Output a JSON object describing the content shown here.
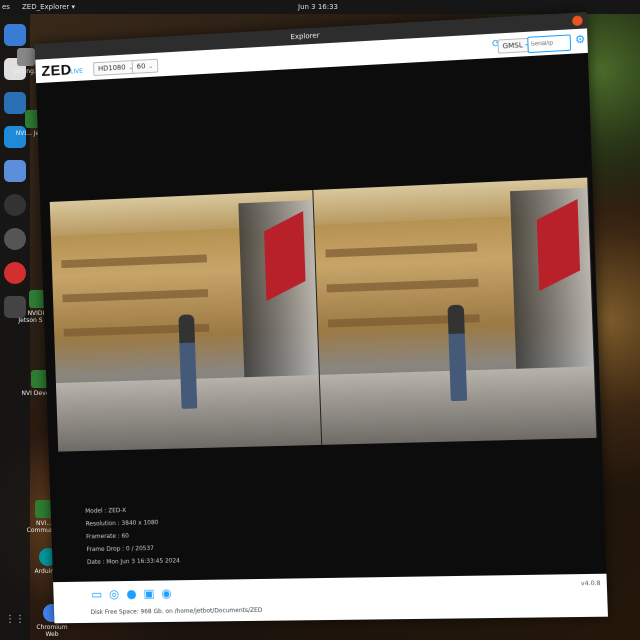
{
  "topbar": {
    "activities": "es",
    "app_menu": "ZED_Explorer ▾",
    "clock": "Jun 3  16:33"
  },
  "desktop_icons": [
    {
      "label": "getting..."
    },
    {
      "label": "NVI... Jetson"
    },
    {
      "label": "NVIDIA Jetson S Foru"
    },
    {
      "label": "NVI Develop"
    },
    {
      "label": "NVI... Community"
    },
    {
      "label": "Arduino I"
    },
    {
      "label": "Chromium Web"
    }
  ],
  "window": {
    "title": "Explorer"
  },
  "toolbar": {
    "logo": "ZED",
    "live_badge": "LIVE",
    "resolution": "HD1080",
    "fps": "60",
    "id_label": "ID",
    "camera_source": "GMSL - 0",
    "sn_label": "SN",
    "serial_placeholder": "Serial/ip"
  },
  "info": {
    "model": "Model : ZED-X",
    "resolution": "Resolution : 3840 x 1080",
    "framerate": "Framerate : 60",
    "frame_drop": "Frame Drop : 0 / 20537",
    "date": "Date : Mon Jun 3 16:33:45 2024"
  },
  "bottombar": {
    "disk_free": "Disk Free Space: 968 Gb. on /home/jetbot/Documents/ZED",
    "version": "v4.0.8"
  }
}
